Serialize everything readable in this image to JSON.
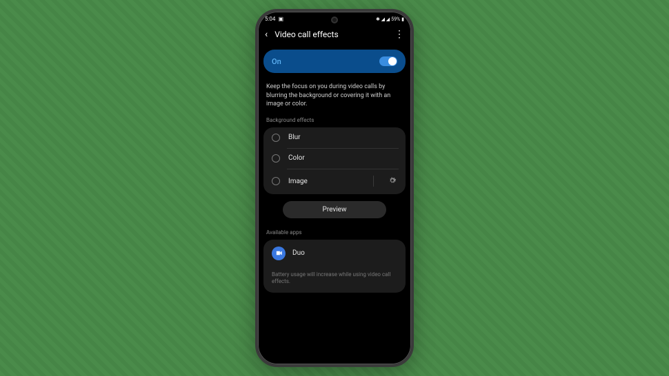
{
  "status": {
    "time": "5:04",
    "battery": "59%",
    "icons": "✱ ✈ ⚡"
  },
  "header": {
    "title": "Video call effects"
  },
  "toggle": {
    "label": "On"
  },
  "description": "Keep the focus on you during video calls by blurring the background or covering it with an image or color.",
  "sections": {
    "background": {
      "label": "Background effects",
      "options": [
        "Blur",
        "Color",
        "Image"
      ]
    },
    "preview": "Preview",
    "apps": {
      "label": "Available apps",
      "items": [
        "Duo"
      ]
    },
    "footnote": "Battery usage will increase while using video call effects."
  }
}
